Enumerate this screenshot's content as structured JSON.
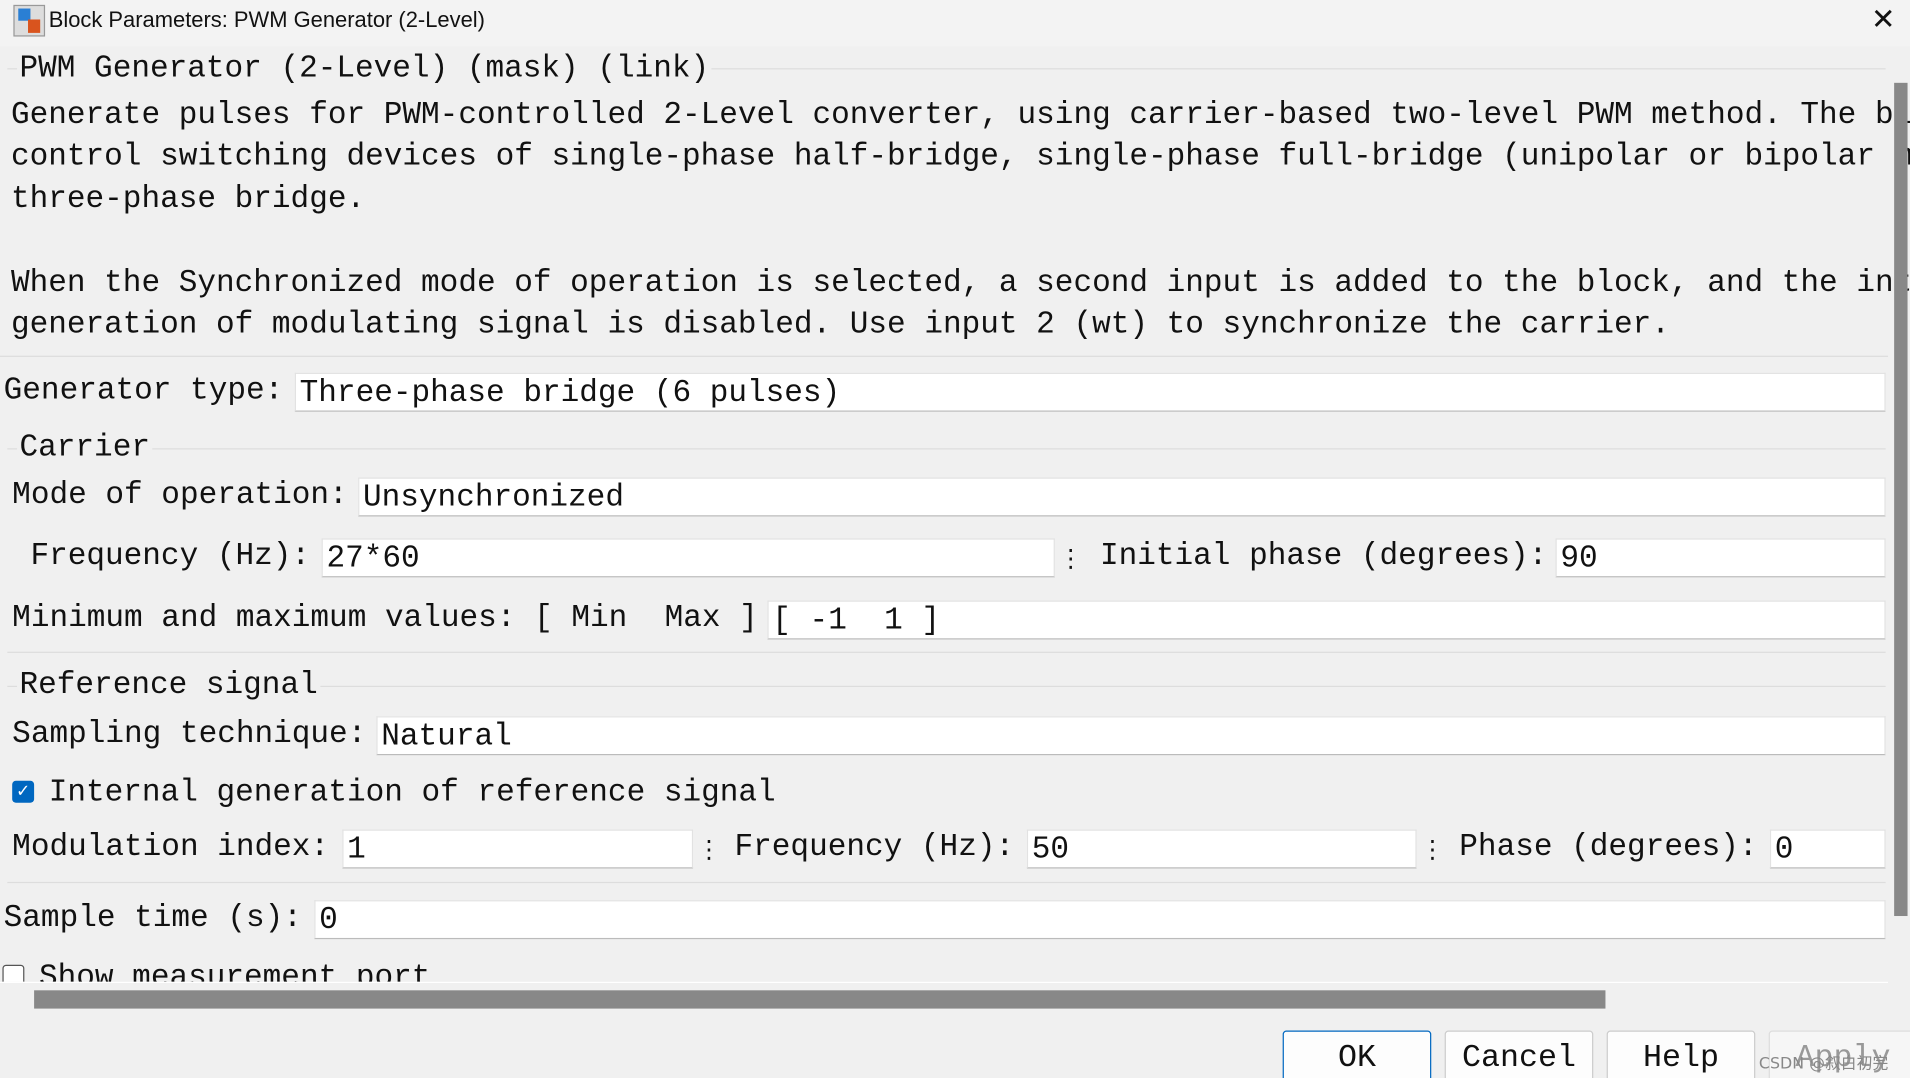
{
  "window": {
    "title": "Block Parameters: PWM Generator (2-Level)",
    "close_icon": "close-icon",
    "app_icon": "simulink-block-icon"
  },
  "header": {
    "title": "PWM Generator (2-Level) (mask) (link)",
    "description": [
      "Generate pulses for PWM-controlled 2-Level converter, using carrier-based two-level PWM method. The bl",
      "control switching devices of single-phase half-bridge, single-phase full-bridge (unipolar or bipolar m",
      "three-phase bridge.",
      "",
      "When the Synchronized mode of operation is selected, a second input is added to the block, and the int",
      "generation of modulating signal is disabled. Use input 2 (wt) to synchronize the carrier."
    ]
  },
  "generator_type": {
    "label": "Generator type:",
    "value": "Three-phase bridge (6 pulses)"
  },
  "carrier": {
    "title": "Carrier",
    "mode": {
      "label": "Mode of operation:",
      "value": "Unsynchronized"
    },
    "frequency": {
      "label": "Frequency (Hz):",
      "value": "27*60"
    },
    "initial_phase": {
      "label": "Initial phase (degrees):",
      "value": "90"
    },
    "minmax": {
      "label": "Minimum and maximum values: [ Min  Max ]",
      "value": "[ -1  1 ]"
    }
  },
  "reference": {
    "title": "Reference signal",
    "sampling": {
      "label": "Sampling technique:",
      "value": "Natural"
    },
    "internal": {
      "label": "Internal generation of reference signal",
      "checked": true
    },
    "modulation_index": {
      "label": "Modulation index:",
      "value": "1"
    },
    "frequency": {
      "label": "Frequency (Hz):",
      "value": "50"
    },
    "phase": {
      "label": "Phase (degrees):",
      "value": "0"
    }
  },
  "sample_time": {
    "label": "Sample time (s):",
    "value": "0"
  },
  "show_measurement": {
    "label": "Show measurement port",
    "checked": false
  },
  "buttons": {
    "ok": "OK",
    "cancel": "Cancel",
    "help": "Help",
    "apply": "Apply"
  },
  "watermark": "CSDN @叙白初完",
  "colors": {
    "accent": "#0067c0",
    "scrollbar": "#888888"
  }
}
